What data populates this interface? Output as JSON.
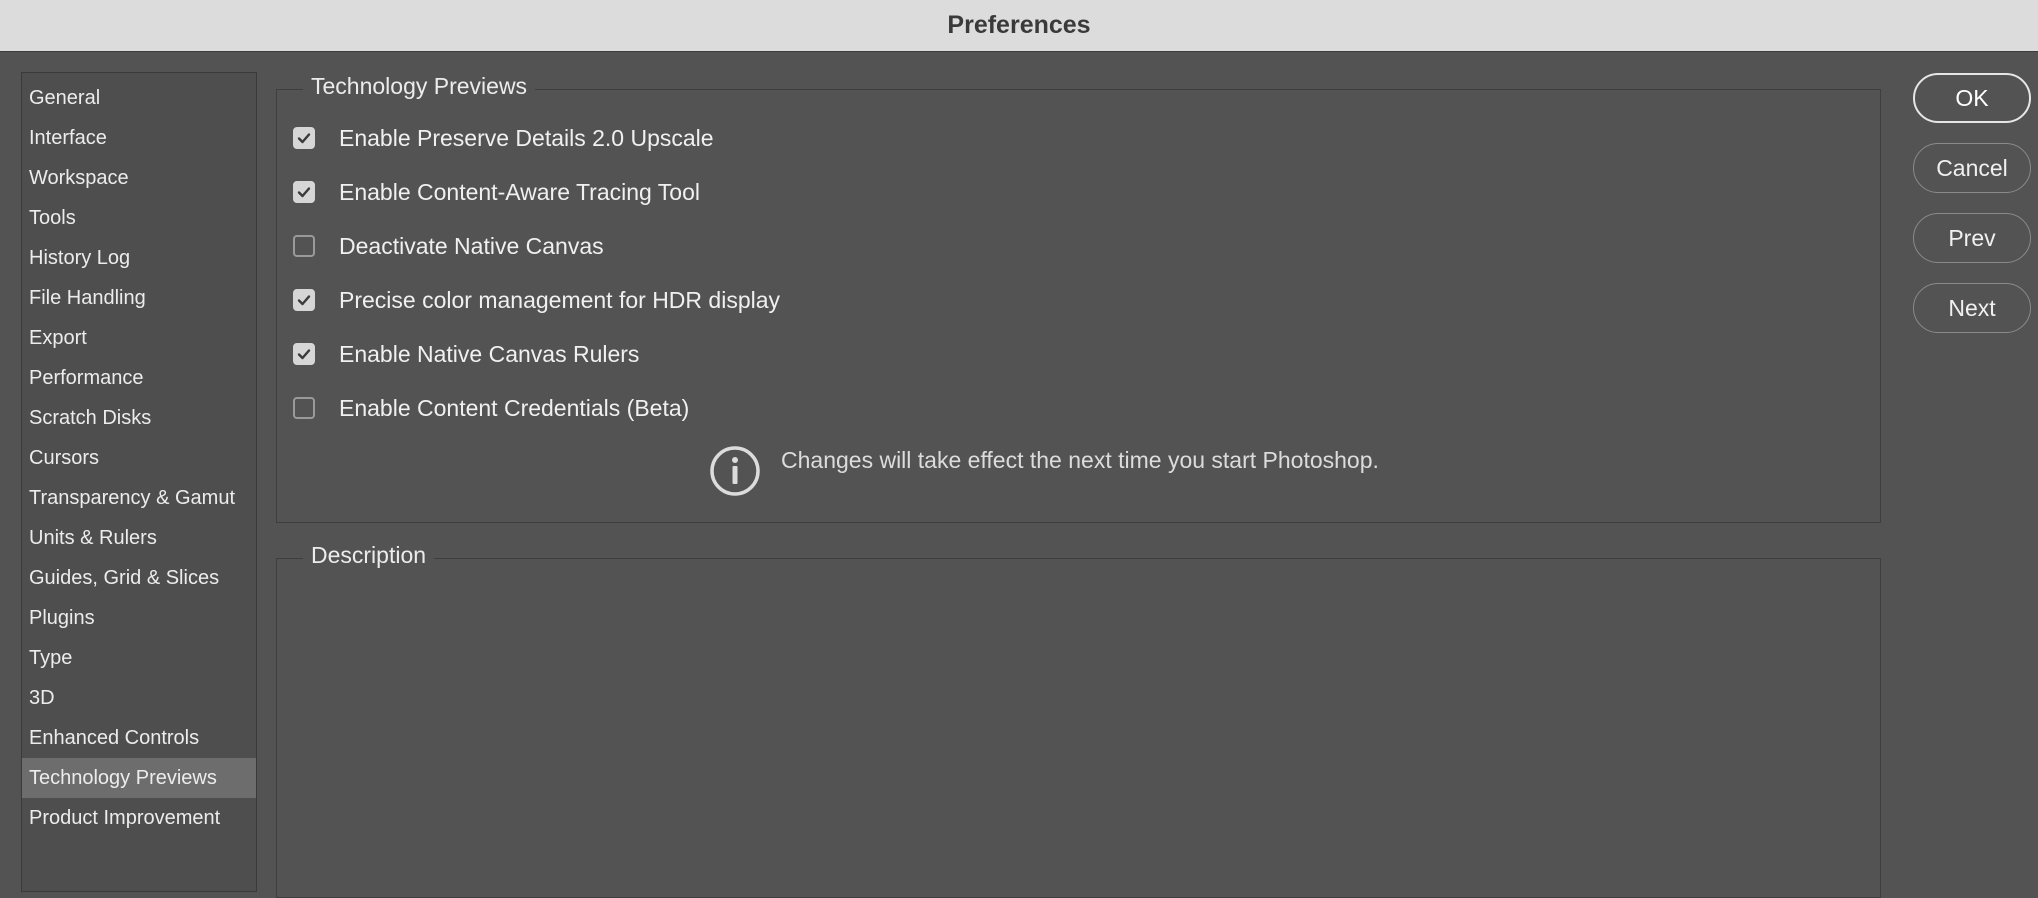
{
  "window": {
    "title": "Preferences"
  },
  "sidebar": {
    "selected_index": 17,
    "items": [
      {
        "label": "General"
      },
      {
        "label": "Interface"
      },
      {
        "label": "Workspace"
      },
      {
        "label": "Tools"
      },
      {
        "label": "History Log"
      },
      {
        "label": "File Handling"
      },
      {
        "label": "Export"
      },
      {
        "label": "Performance"
      },
      {
        "label": "Scratch Disks"
      },
      {
        "label": "Cursors"
      },
      {
        "label": "Transparency & Gamut"
      },
      {
        "label": "Units & Rulers"
      },
      {
        "label": "Guides, Grid & Slices"
      },
      {
        "label": "Plugins"
      },
      {
        "label": "Type"
      },
      {
        "label": "3D"
      },
      {
        "label": "Enhanced Controls"
      },
      {
        "label": "Technology Previews"
      },
      {
        "label": "Product Improvement"
      }
    ]
  },
  "technology_previews": {
    "title": "Technology Previews",
    "options": [
      {
        "label": "Enable Preserve Details 2.0 Upscale",
        "checked": true
      },
      {
        "label": "Enable Content-Aware Tracing Tool",
        "checked": true
      },
      {
        "label": "Deactivate Native Canvas",
        "checked": false
      },
      {
        "label": "Precise color management for HDR display",
        "checked": true
      },
      {
        "label": "Enable Native Canvas Rulers",
        "checked": true
      },
      {
        "label": "Enable Content Credentials (Beta)",
        "checked": false
      }
    ],
    "info": {
      "icon": "info-icon",
      "text": "Changes will take effect the next time you start Photoshop."
    }
  },
  "description": {
    "title": "Description"
  },
  "buttons": {
    "ok": "OK",
    "cancel": "Cancel",
    "prev": "Prev",
    "next": "Next"
  }
}
